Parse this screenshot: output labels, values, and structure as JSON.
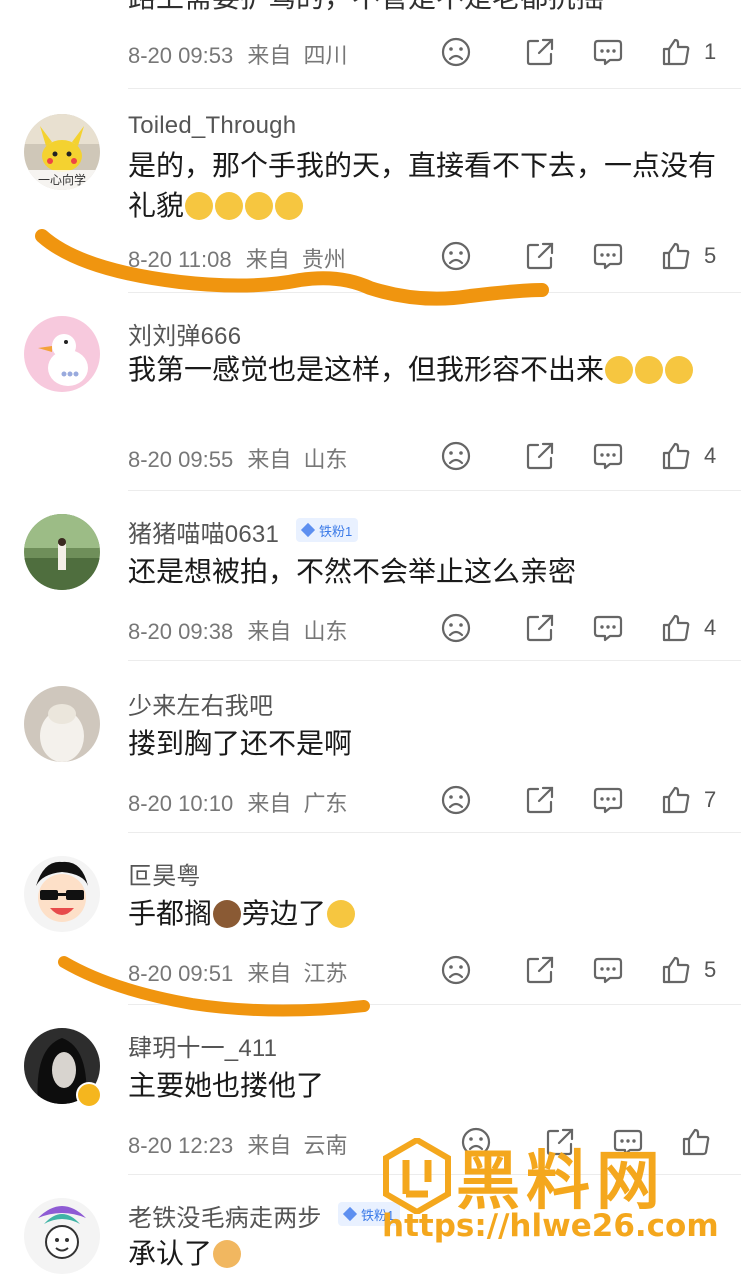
{
  "comments": [
    {
      "username": "",
      "content": "",
      "time": "8-20 09:53",
      "from_label": "来自",
      "location": "四川",
      "likes": "1"
    },
    {
      "username": "Toiled_Through",
      "content": "是的，那个手我的天，直接看不下去，一点没有礼貌",
      "emoji": "🙂🙂🙂🙂",
      "time": "8-20 11:08",
      "from_label": "来自",
      "location": "贵州",
      "likes": "5"
    },
    {
      "username": "刘刘弹666",
      "content": "我第一感觉也是这样，但我形容不出来",
      "emoji": "😂😂😂",
      "time": "8-20 09:55",
      "from_label": "来自",
      "location": "山东",
      "likes": "4"
    },
    {
      "username": "猪猪喵喵0631",
      "badge": "铁粉1",
      "content": "还是想被拍，不然不会举止这么亲密",
      "time": "8-20 09:38",
      "from_label": "来自",
      "location": "山东",
      "likes": "4"
    },
    {
      "username": "少来左右我吧",
      "content": "搂到胸了还不是啊",
      "time": "8-20 10:10",
      "from_label": "来自",
      "location": "广东",
      "likes": "7"
    },
    {
      "username": "叵昊粤",
      "content_a": "手都搁",
      "content_b": "旁边了",
      "emoji_a": "🐻",
      "emoji_b": "😭",
      "time": "8-20 09:51",
      "from_label": "来自",
      "location": "江苏",
      "likes": "5"
    },
    {
      "username": "肆玥十一_411",
      "content": "主要她也搂他了",
      "time": "8-20 12:23",
      "from_label": "来自",
      "location": "云南",
      "likes": ""
    },
    {
      "username": "老铁没毛病走两步",
      "badge": "铁粉1",
      "content": "承认了",
      "emoji": "🐱"
    }
  ],
  "icons": [
    "frown-icon",
    "share-icon",
    "comment-icon",
    "thumbs-up-icon"
  ],
  "colors": {
    "text": "#1a1a1a",
    "meta": "#777777",
    "scribble": "#f0950f",
    "watermark": "#f4a71d"
  },
  "watermark": {
    "title": "黑料网",
    "url": "https://hlwe26.com"
  }
}
